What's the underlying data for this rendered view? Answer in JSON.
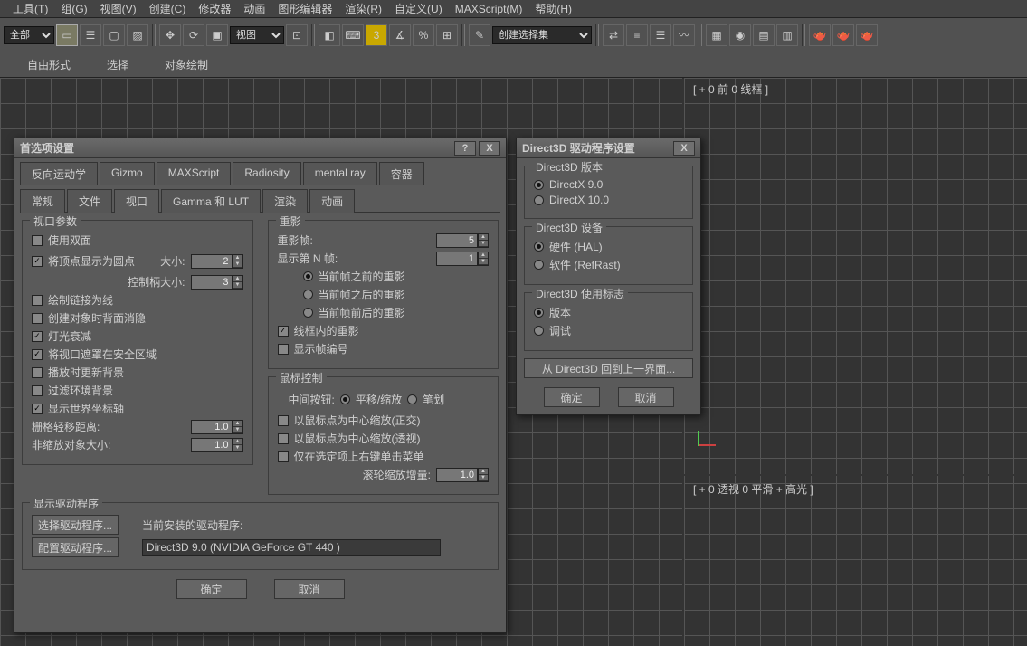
{
  "menu": {
    "tools": "工具(T)",
    "group": "组(G)",
    "view": "视图(V)",
    "create": "创建(C)",
    "modifiers": "修改器",
    "animation": "动画",
    "graph": "图形编辑器",
    "render": "渲染(R)",
    "custom": "自定义(U)",
    "maxscript": "MAXScript(M)",
    "help": "帮助(H)"
  },
  "toolbar": {
    "allSel": "全部",
    "viewDD": "视图",
    "selSet": "创建选择集"
  },
  "secondbar": {
    "freeform": "自由形式",
    "select": "选择",
    "objPaint": "对象绘制"
  },
  "viewportLabels": {
    "front": "[ + 0 前 0 线框 ]",
    "persp": "[ + 0 透视 0 平滑 + 高光 ]"
  },
  "prefs": {
    "title": "首选项设置",
    "tabsTop": [
      "反向运动学",
      "Gizmo",
      "MAXScript",
      "Radiosity",
      "mental ray",
      "容器"
    ],
    "tabsBot": [
      "常规",
      "文件",
      "视口",
      "Gamma 和 LUT",
      "渲染",
      "动画"
    ],
    "vpParams": {
      "title": "视口参数",
      "useDual": "使用双面",
      "vertAsDot": "将顶点显示为圆点",
      "sizeLbl": "大小:",
      "sizeVal": "2",
      "handleSize": "控制柄大小:",
      "handleVal": "3",
      "drawLinks": "绘制链接为线",
      "backfaceCull": "创建对象时背面消隐",
      "lightAtten": "灯光衰减",
      "safeFrame": "将视口遮罩在安全区域",
      "updateBG": "播放时更新背景",
      "filterBG": "过滤环境背景",
      "showAxis": "显示世界坐标轴",
      "nudgeDist": "栅格轻移距离:",
      "nudgeVal": "1.0",
      "nonScale": "非缩放对象大小:",
      "nonScaleVal": "1.0"
    },
    "ghost": {
      "title": "重影",
      "frames": "重影帧:",
      "framesVal": "5",
      "showN": "显示第 N 帧:",
      "showNVal": "1",
      "before": "当前帧之前的重影",
      "after": "当前帧之后的重影",
      "both": "当前帧前后的重影",
      "wire": "线框内的重影",
      "frameNum": "显示帧编号"
    },
    "mouse": {
      "title": "鼠标控制",
      "midBtn": "中间按钮:",
      "pan": "平移/缩放",
      "stroke": "笔划",
      "orthoCtr": "以鼠标点为中心缩放(正交)",
      "perspCtr": "以鼠标点为中心缩放(透视)",
      "rclickMenu": "仅在选定项上右键单击菜单",
      "wheelInc": "滚轮缩放增量:",
      "wheelVal": "1.0"
    },
    "driver": {
      "title": "显示驱动程序",
      "choose": "选择驱动程序...",
      "config": "配置驱动程序...",
      "installed": "当前安装的驱动程序:",
      "value": "Direct3D 9.0 (NVIDIA GeForce GT 440 )"
    },
    "ok": "确定",
    "cancel": "取消"
  },
  "d3d": {
    "title": "Direct3D 驱动程序设置",
    "version": {
      "title": "Direct3D 版本",
      "dx9": "DirectX 9.0",
      "dx10": "DirectX 10.0"
    },
    "device": {
      "title": "Direct3D 设备",
      "hal": "硬件 (HAL)",
      "ref": "软件 (RefRast)"
    },
    "flags": {
      "title": "Direct3D 使用标志",
      "ver": "版本",
      "debug": "调试"
    },
    "back": "从 Direct3D 回到上一界面...",
    "ok": "确定",
    "cancel": "取消"
  }
}
